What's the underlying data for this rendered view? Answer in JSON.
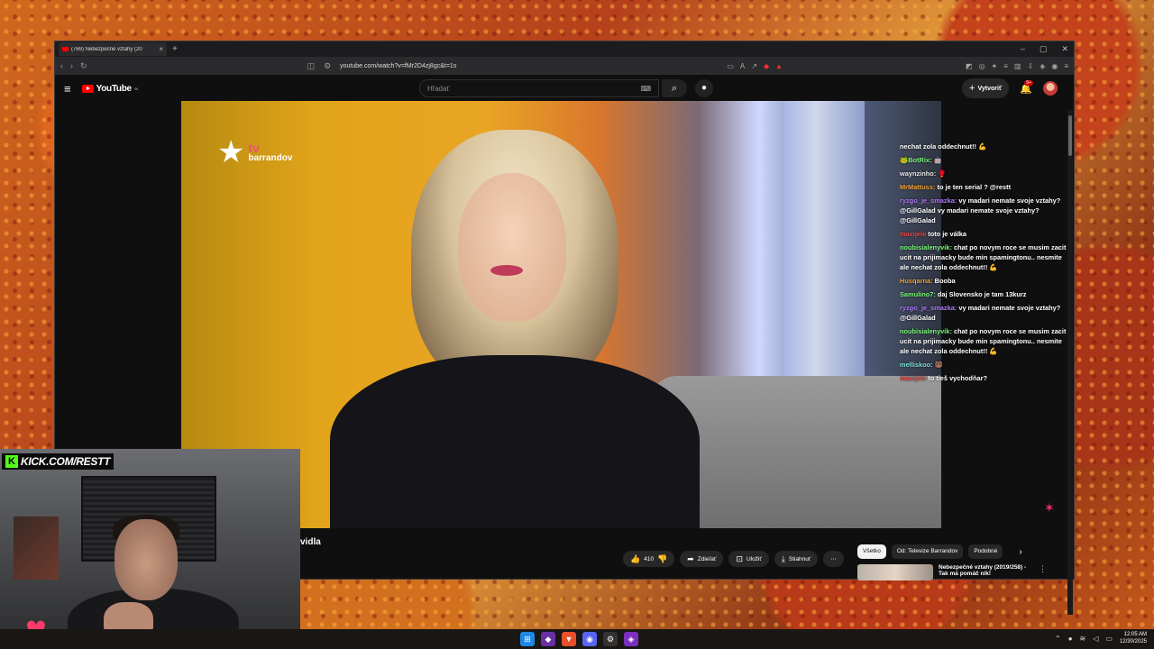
{
  "browser": {
    "tab_title": "(769) Nebezpečné vztahy (20",
    "url": "youtube.com/watch?v=fMr2D4zj8gc&t=1s",
    "new_tab_glyph": "+",
    "tab_close_glyph": "×",
    "win_min": "–",
    "win_max": "▢",
    "win_close": "✕"
  },
  "youtube": {
    "logo_text": "YouTube",
    "region": "SK",
    "search_placeholder": "Hľadať",
    "create_label": "Vytvoriť",
    "notif_count": "9+"
  },
  "video": {
    "channel_brand_tv": "tv",
    "channel_brand_name": "barrandov",
    "title_fragment": "vidla"
  },
  "actions": {
    "like_count": "410",
    "share_label": "Zdieľať",
    "save_label": "Uložiť",
    "download_label": "Stiahnuť",
    "more_glyph": "⋯"
  },
  "chips": [
    {
      "label": "Všetko"
    },
    {
      "label": "Od: Televize Barrandov"
    },
    {
      "label": "Podobné"
    }
  ],
  "recommendation": {
    "title": "Nebezpečné vztahy (2019/258) - Tak má pomáč nik!"
  },
  "chat": [
    {
      "name": "",
      "text": "nechat zola oddechnut!! 💪",
      "color": "#ffffff"
    },
    {
      "name": "🐸BotRix:",
      "text": "🤖",
      "color": "#7cfc7c"
    },
    {
      "name": "waynzinho:",
      "text": "🥊",
      "color": "#e8e8e8"
    },
    {
      "name": "MrMattuss:",
      "text": "to je ten serial ? @restt",
      "color": "#f2a33c"
    },
    {
      "name": "ryzgo_je_smazka:",
      "text": "vy madari nemate svoje vztahy? @GillGalad vy madari nemate svoje vztahy? @GillGalad",
      "color": "#b07cff"
    },
    {
      "name": "maxijele",
      "text": "toto je válka",
      "color": "#e84d4d"
    },
    {
      "name": "noubisialenyvik:",
      "text": "chat po novym roce se musim zacit ucit na prijimacky bude min spamingtonu.. nesmite ale nechat zola oddechnut!! 💪",
      "color": "#7cfc7c"
    },
    {
      "name": "Husqarna:",
      "text": "Booba",
      "color": "#f2a33c"
    },
    {
      "name": "Samulino7:",
      "text": "daj Slovensko je tam 13kurz",
      "color": "#7cfc7c"
    },
    {
      "name": "ryzgo_je_smazka:",
      "text": "vy madari nemate svoje vztahy? @GillGalad",
      "color": "#b07cff"
    },
    {
      "name": "noubisialenyvik:",
      "text": "chat po novym roce se musim zacit ucit na prijimacky bude min spamingtonu.. nesmite ale nechat zola oddechnut!! 💪",
      "color": "#7cfc7c"
    },
    {
      "name": "melliskoo:",
      "text": "🐻",
      "color": "#7ce0e0"
    },
    {
      "name": "maxijele",
      "text": "to tieš vychodňar?",
      "color": "#e84d4d"
    }
  ],
  "webcam": {
    "kick_letter": "K",
    "kick_text": "KICK.COM/RESTT"
  },
  "taskbar": {
    "time": "12:05 AM",
    "date": "12/30/2025"
  }
}
